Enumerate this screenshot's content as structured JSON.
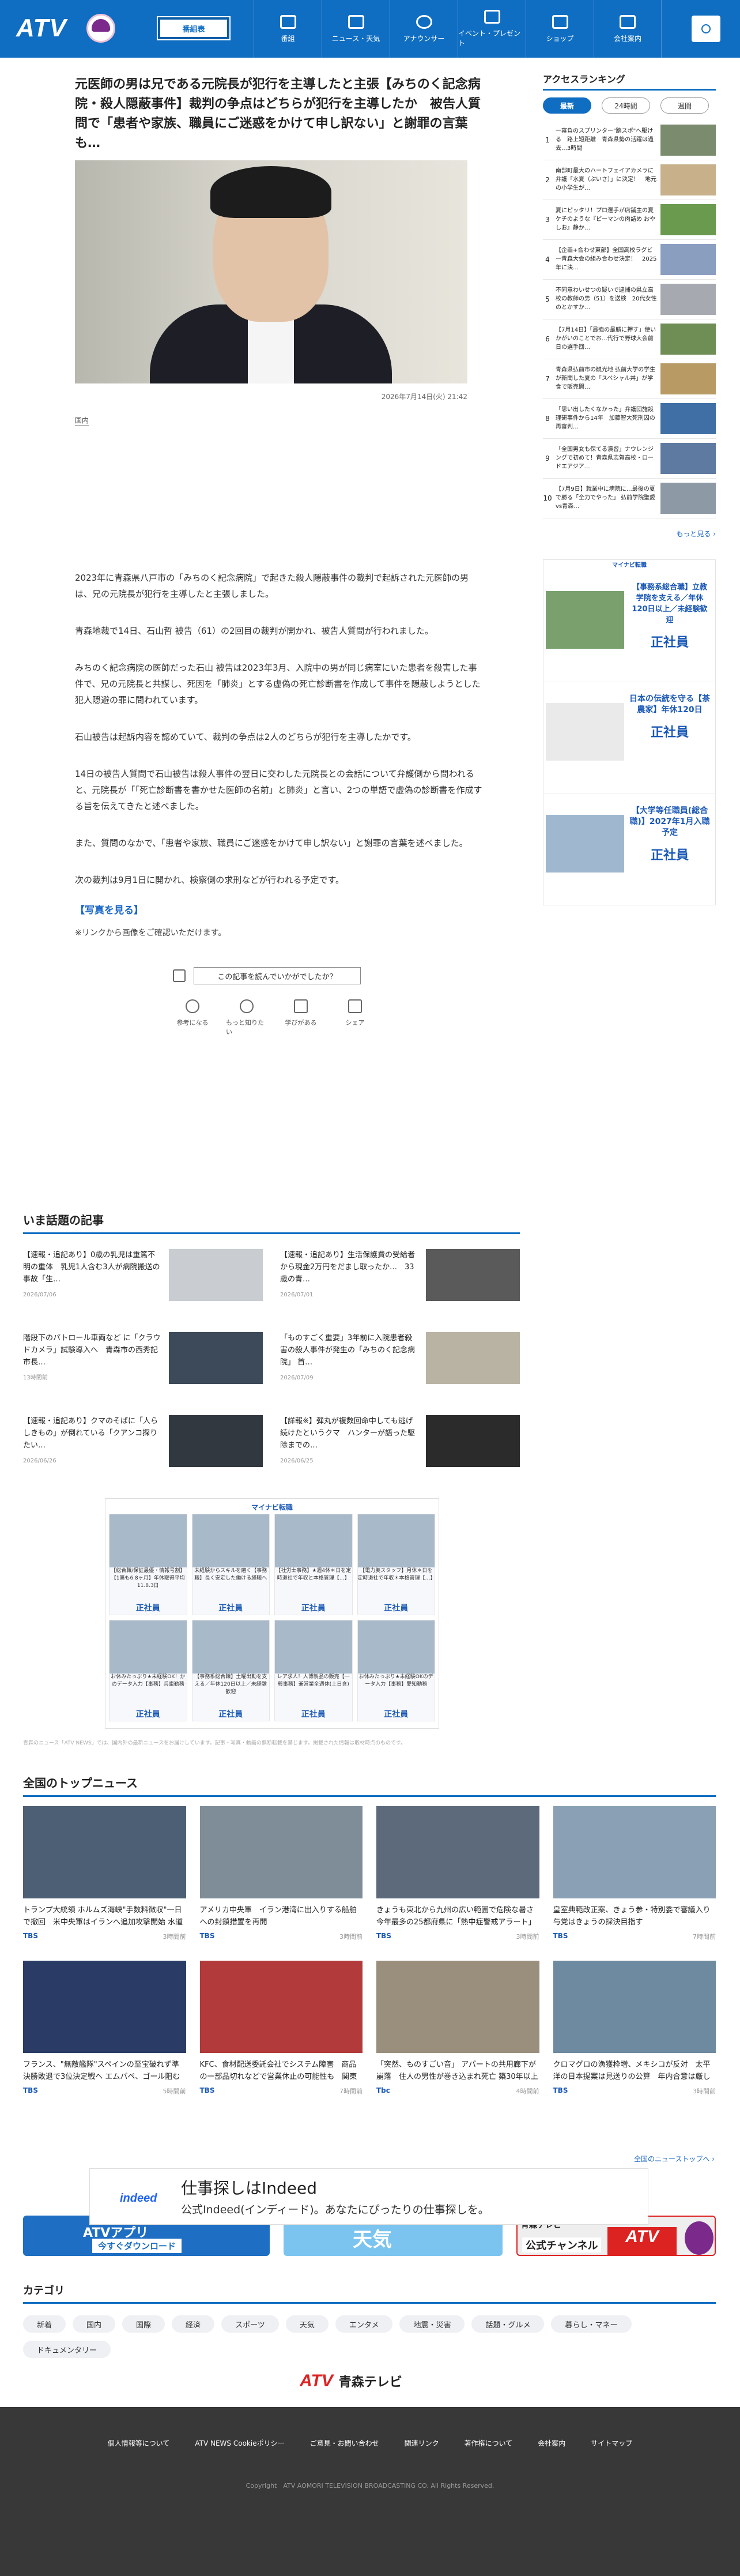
{
  "header": {
    "logo": "ATV",
    "selector": "番組表",
    "nav": [
      "番組",
      "ニュース・天気",
      "アナウンサー",
      "イベント・プレゼント",
      "ショップ",
      "会社案内"
    ]
  },
  "article": {
    "title": "元医師の男は兄である元院長が犯行を主導したと主張【みちのく記念病院・殺人隠蔽事件】裁判の争点はどちらが犯行を主導したか　被告人質問で「患者や家族、職員にご迷惑をかけて申し訳ない」と謝罪の言葉も…",
    "date": "2026年7月14日(火) 21:42",
    "category": "国内",
    "paragraphs": [
      "2023年に青森県八戸市の「みちのく記念病院」で起きた殺人隠蔽事件の裁判で起訴された元医師の男は、兄の元院長が犯行を主導したと主張しました。",
      "青森地裁で14日、石山哲 被告（61）の2回目の裁判が開かれ、被告人質問が行われました。",
      "みちのく記念病院の医師だった石山 被告は2023年3月、入院中の男が同じ病室にいた患者を殺害した事件で、兄の元院長と共謀し、死因を「肺炎」とする虚偽の死亡診断書を作成して事件を隠蔽しようとした犯人隠避の罪に問われています。",
      "石山被告は起訴内容を認めていて、裁判の争点は2人のどちらが犯行を主導したかです。",
      "14日の被告人質問で石山被告は殺人事件の翌日に交わした元院長との会話について弁護側から問われると、元院長が「「死亡診断書を書かせた医師の名前」と肺炎」と言い、2つの単語で虚偽の診断書を作成する旨を伝えてきたと述べました。",
      "また、質問のなかで、「患者や家族、職員にご迷惑をかけて申し訳ない」と謝罪の言葉を述べました。",
      "次の裁判は9月1日に開かれ、検察側の求刑などが行われる予定です。"
    ],
    "photos_link": "【写真を見る】",
    "note": "※リンクから画像をご確認いただけます。",
    "reaction_prompt": "この記事を読んでいかがでしたか？",
    "reactions": [
      "参考になる",
      "もっと知りたい",
      "学びがある",
      "シェア"
    ]
  },
  "popular": {
    "heading": "いま話題の記事",
    "items": [
      {
        "title": "【速報・追記あり】0歳の乳児は重篤不明の重体　乳児1人含む3人が病院搬送の事故「生…",
        "date": "2026/07/06"
      },
      {
        "title": "【速報・追記あり】生活保護費の受給者から現金2万円をだまし取ったか…　33歳の青…",
        "date": "2026/07/01"
      },
      {
        "title": "階段下のパトロール車両など に「クラウドカメラ」試験導入へ　青森市の西秀記 市長…",
        "date": "13時間前"
      },
      {
        "title": "「ものすごく重要」3年前に入院患者殺害の殺人事件が発生の「みちのく記念病院」 首…",
        "date": "2026/07/09"
      },
      {
        "title": "【速報・追記あり】クマのそばに「人らしきもの」が倒れている「クアンコ探りたい…",
        "date": "2026/06/26"
      },
      {
        "title": "【詳報※】弾丸が複数回命中しても逃げ続けたというクマ　ハンターが語った駆除までの…",
        "date": "2026/06/25"
      }
    ]
  },
  "ad_grid": {
    "brand": "マイナビ転職",
    "items": [
      {
        "text": "【総合職/保証最優・情報号割】【1第も6.8ヶ月】年休取得平均11.8.3日",
        "pos": "正社員"
      },
      {
        "text": "未経験からスキルを磨く【事務職】長く安定した働ける経職へ",
        "pos": "正社員"
      },
      {
        "text": "【社労士事務】★週4休＊日を定時退社で年収と本格管理【…】",
        "pos": "正社員"
      },
      {
        "text": "【電力美スタッフ】月休＊日を定時退社で年収＊本格管理【…】",
        "pos": "正社員"
      },
      {
        "text": "お休みたっぷり★未経験OK！かのデータ入力【事務】兵庫勤務",
        "pos": "正社員"
      },
      {
        "text": "【事務系総合職】土曜出勤を支える／年休120日以上／未経験歓迎",
        "pos": "正社員"
      },
      {
        "text": "レア求人！人博製品の販売【一般事務】兼営業全週休(土日含)",
        "pos": "正社員"
      },
      {
        "text": "お休みたっぷり★未経験OKのデータ入力【事務】愛知勤務",
        "pos": "正社員"
      }
    ]
  },
  "disclaimer": "青森のニュース「ATV NEWS」では、国内外の最新ニュースをお届けしています。記事・写真・動画の無断転載を禁じます。掲載された情報は取材時点のものです。",
  "top_news": {
    "heading": "全国のトップニュース",
    "items": [
      {
        "title": "トランプ大統領 ホルムズ海峡\"手数料徴収\"一日で撤回　米中央軍はイランへ追加攻撃開始 水道や電力関連施設…",
        "src": "TBS",
        "time": "3時間前"
      },
      {
        "title": "アメリカ中央軍　イラン港湾に出入りする船舶への封鎖措置を再開",
        "src": "TBS",
        "time": "3時間前"
      },
      {
        "title": "きょうも東北から九州の広い範囲で危険な暑さ 今年最多の25都府県に「熱中症警戒アラート」発表",
        "src": "TBS",
        "time": "3時間前"
      },
      {
        "title": "皇室典範改正案、きょう参・特別委で審議入り　与党はきょうの採決目指す",
        "src": "TBS",
        "time": "7時間前"
      },
      {
        "title": "フランス、\"無敵艦隊\"スペインの至宝破れず準決勝敗退で3位決定戦へ エムバペ、ゴール阻む【W杯北中米…",
        "src": "TBS",
        "time": "5時間前"
      },
      {
        "title": "KFC、食材配送委託会社でシステム障害　商品の一部品切れなどで営業休止の可能性も　関東甲信越の一部…",
        "src": "TBS",
        "time": "7時間前"
      },
      {
        "title": "「突然、ものすごい音」 アパートの共用廊下が崩落　住人の男性が巻き込まれ死亡 築30年以上経過か…",
        "src": "Tbc",
        "time": "4時間前"
      },
      {
        "title": "クロマグロの漁獲枠増、メキシコが反対　太平洋の日本提案は見送りの公算　年内合意は厳しい状況に",
        "src": "TBS",
        "time": "3時間前"
      }
    ],
    "more": "全国のニューストップへ ›"
  },
  "indeed": {
    "logo": "indeed",
    "title": "仕事探しはIndeed",
    "sub": "公式Indeed(インディード)。あなたにぴったりの仕事探しを。"
  },
  "banners": {
    "app": "ATVアプリ",
    "app_cta": "今すぐダウンロード",
    "weather": "天気",
    "yt1": "青森テレビ",
    "yt2": "公式チャンネル",
    "yt_logo": "ATV"
  },
  "categories": {
    "heading": "カテゴリ",
    "items": [
      "新着",
      "国内",
      "国際",
      "経済",
      "スポーツ",
      "天気",
      "エンタメ",
      "地震・災害",
      "話題・グルメ",
      "暮らし・マネー",
      "ドキュメンタリー"
    ]
  },
  "footer_logo": {
    "a": "ATV",
    "b": "青森テレビ"
  },
  "footer": {
    "links": [
      "個人情報等について",
      "ATV NEWS Cookieポリシー",
      "ご意見・お問い合わせ",
      "関連リンク",
      "著作権について",
      "会社案内",
      "サイトマップ"
    ],
    "copyright": "Copyright　ATV AOMORI TELEVISION BROADCASTING CO. All Rights Reserved."
  },
  "ranking": {
    "heading": "アクセスランキング",
    "tabs": [
      "最新",
      "24時間",
      "週間"
    ],
    "items": [
      "一審負のスプリンター\"踏スポ\"へ駆ける　路上短距離　青森県勢の活躍は過去…3時間",
      "南部町最大のハートフェイアカメラに弁護「水夏（ぷいさ）」に決定！　地元の小学生が…",
      "夏にピッタリ！プロ選手が店舗主の夏ケチのような『ピーマンの肉詰め おやしお』静か…",
      "【企画+合わせ東部】全国高校ラグビー青森大会の組み合わせ決定！　2025年に決…",
      "不同意わいせつの疑いで逮捕の県立高校の教師の男（51）を送検　20代女性のとかすか…",
      "【7月14日】「最強の最勝に押す」使いかがいのことでお…代行で野球大会前日の選手団…",
      "青森県弘前市の観光地 弘前大学の学生が新聞した夏の「スペシャル丼」が学食で販売開…",
      "「思い出したくなかった」弁護団施設理研事件から14年　加藤智大死刑囚の再審判…",
      "「全国男女も保てる演習」ナウレンジングで初めて！青森県志賀高校・ロードエアジア…",
      "【7月9日】就業中に病院に…最後の夏で勝る「全力でやった」 弘前学院聖愛vs青森…"
    ],
    "more": "もっと見る ›"
  },
  "ad_side": {
    "brand": "マイナビ転職",
    "items": [
      {
        "text": "【事務系総合職】立教学院を支える／年休120日以上／未経験歓迎",
        "pos": "正社員"
      },
      {
        "text": "日本の伝統を守る【茶農家】年休120日",
        "pos": "正社員"
      },
      {
        "text": "【大学等任職員(総合職)】2027年1月入職予定",
        "pos": "正社員"
      }
    ]
  }
}
